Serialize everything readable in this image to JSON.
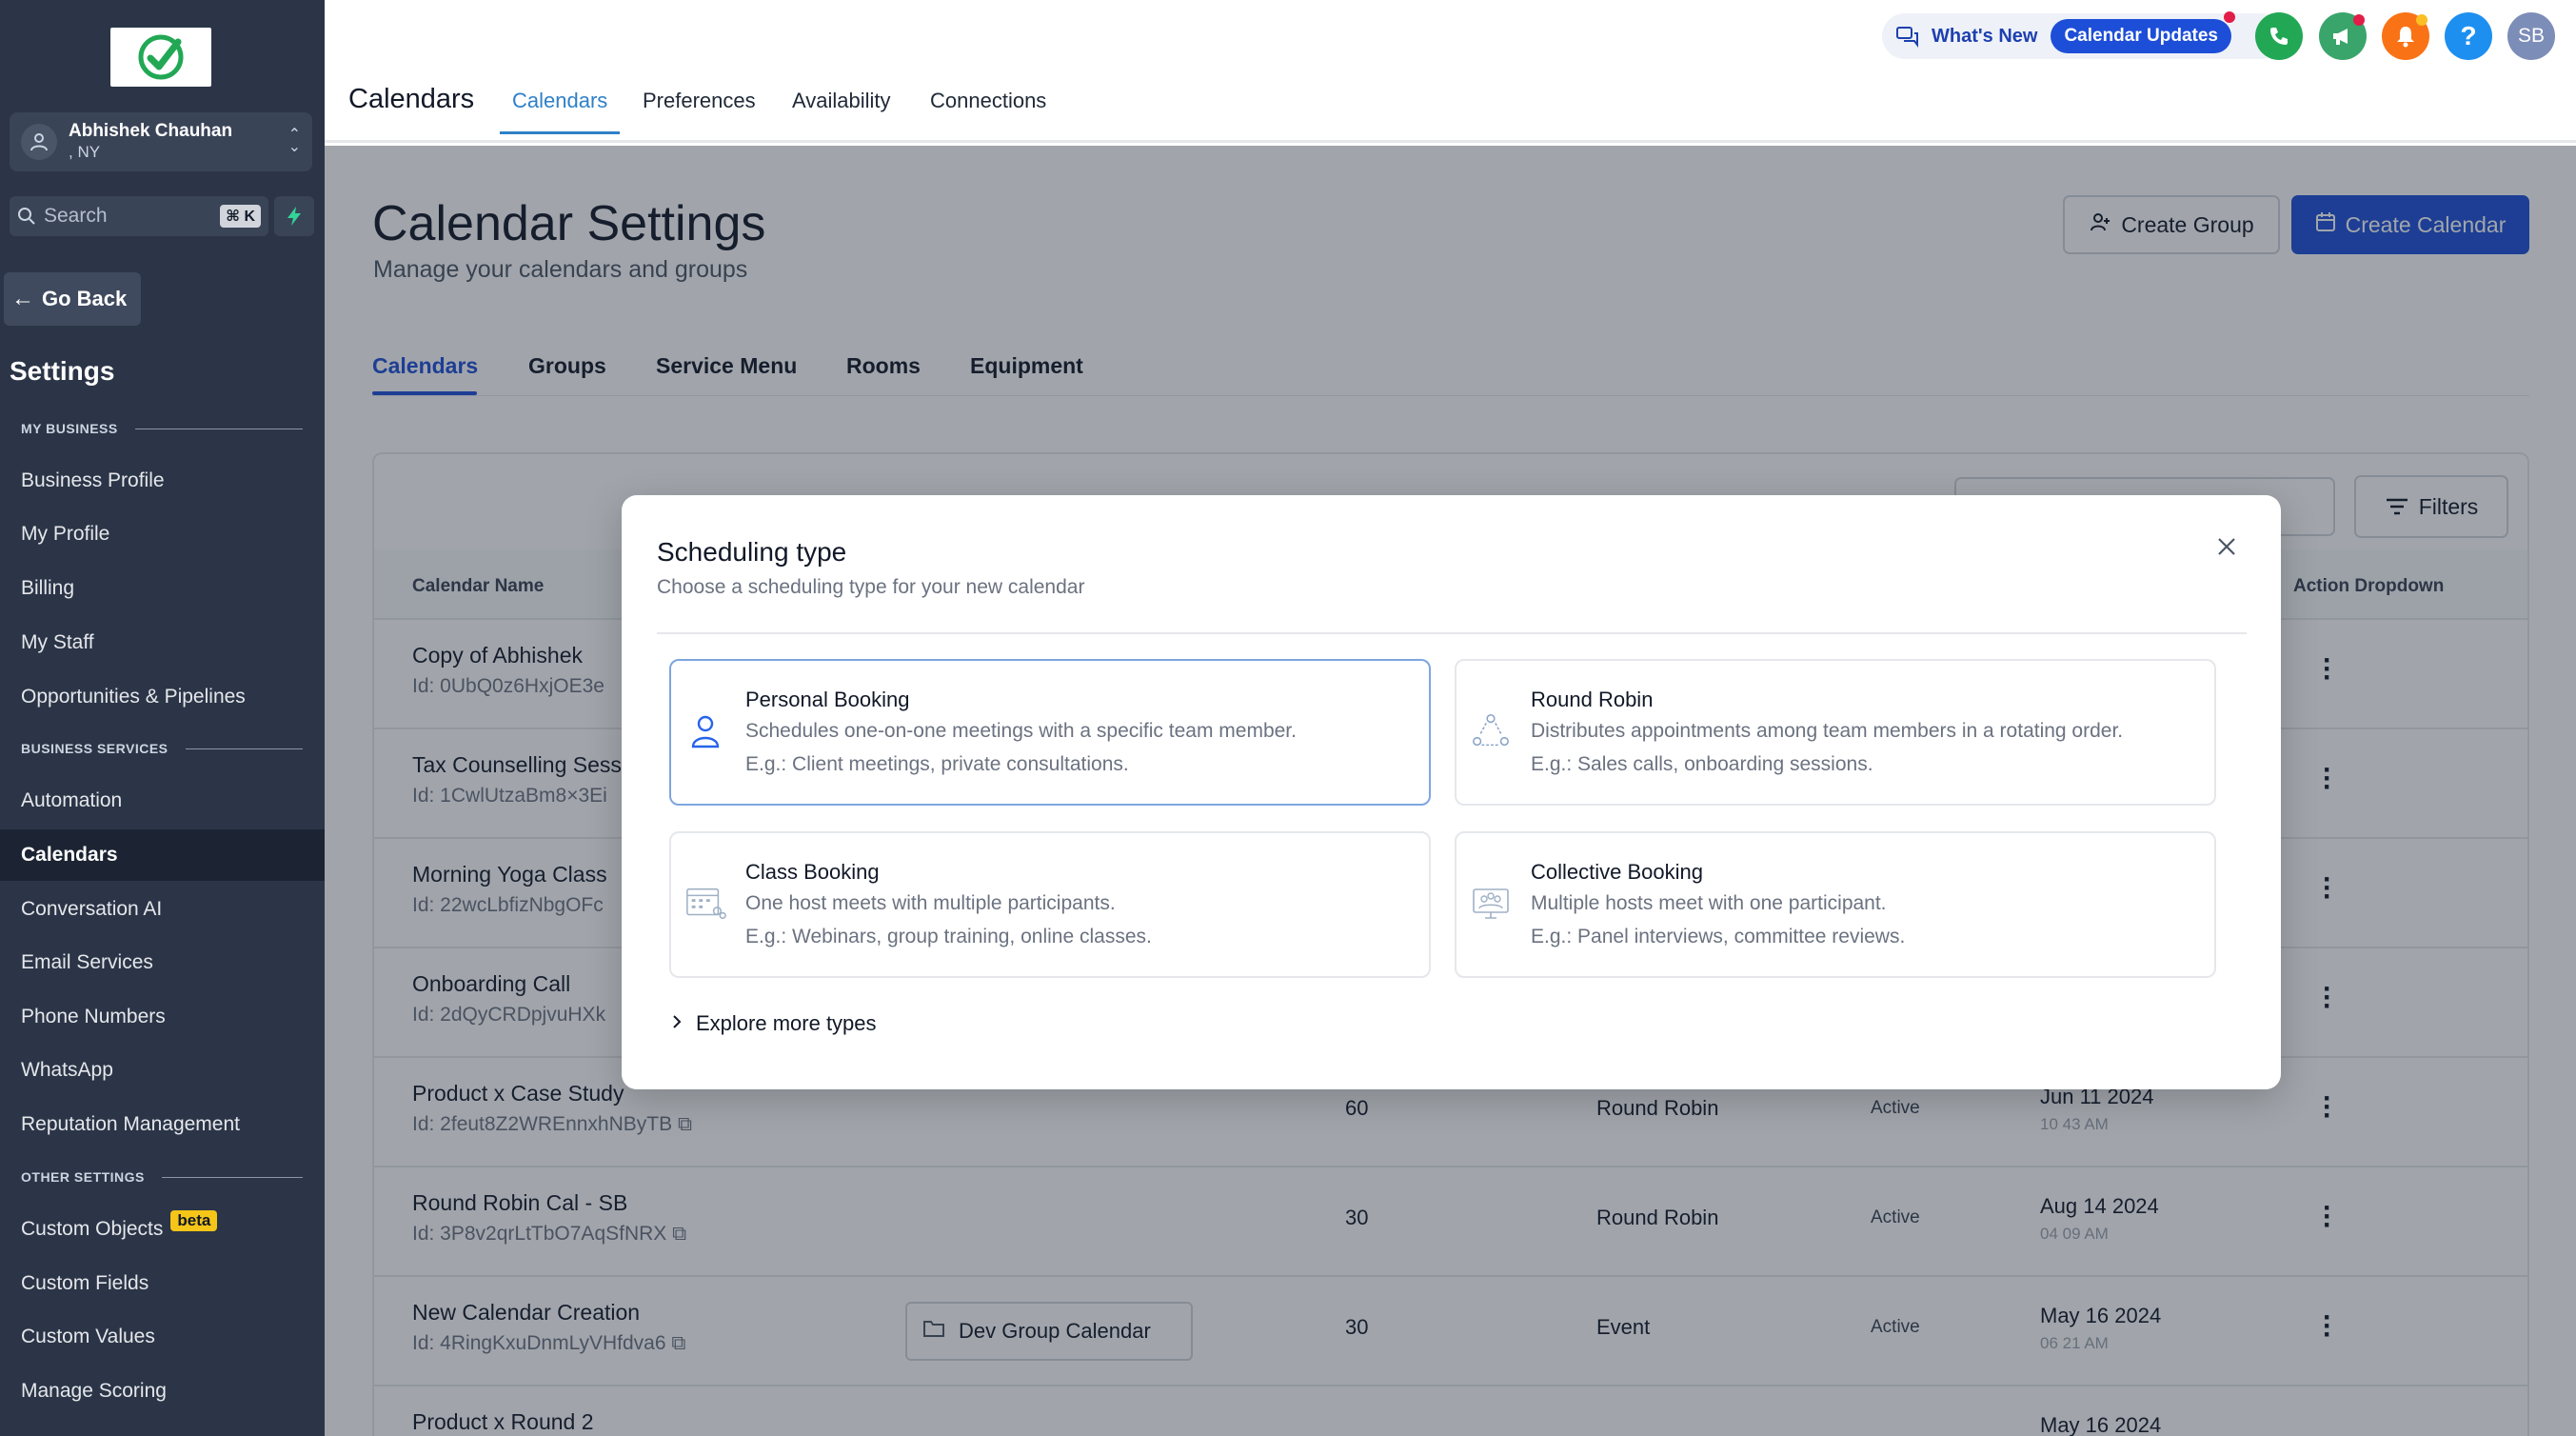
{
  "sidebar": {
    "account": {
      "name": "Abhishek Chauhan",
      "location": ", NY"
    },
    "search": {
      "placeholder": "Search",
      "shortcut": "⌘ K"
    },
    "go_back": "Go Back",
    "title": "Settings",
    "sections": {
      "my_business": "MY BUSINESS",
      "business_services": "BUSINESS SERVICES",
      "other_settings": "OTHER SETTINGS"
    },
    "items": [
      {
        "label": "Business Profile"
      },
      {
        "label": "My Profile"
      },
      {
        "label": "Billing"
      },
      {
        "label": "My Staff"
      },
      {
        "label": "Opportunities & Pipelines"
      },
      {
        "label": "Automation"
      },
      {
        "label": "Calendars"
      },
      {
        "label": "Conversation AI"
      },
      {
        "label": "Email Services"
      },
      {
        "label": "Phone Numbers"
      },
      {
        "label": "WhatsApp"
      },
      {
        "label": "Reputation Management"
      },
      {
        "label": "Custom Objects",
        "badge": "beta"
      },
      {
        "label": "Custom Fields"
      },
      {
        "label": "Custom Values"
      },
      {
        "label": "Manage Scoring"
      }
    ]
  },
  "header": {
    "title": "Calendars",
    "tabs": [
      "Calendars",
      "Preferences",
      "Availability",
      "Connections"
    ],
    "whats_new": "What's New",
    "calendar_updates": "Calendar Updates",
    "avatar": "SB",
    "help": "?"
  },
  "main": {
    "title": "Calendar Settings",
    "subtitle": "Manage your calendars and groups",
    "create_group": "Create Group",
    "create_calendar": "Create Calendar",
    "subtabs": [
      "Calendars",
      "Groups",
      "Service Menu",
      "Rooms",
      "Equipment"
    ],
    "filters": "Filters",
    "columns": {
      "name": "Calendar Name",
      "action": "Action Dropdown"
    },
    "rows": [
      {
        "name": "Copy of Abhishek",
        "id": "Id: 0UbQ0z6HxjOE3e"
      },
      {
        "name": "Tax Counselling Sess",
        "id": "Id: 1CwlUtzaBm8×3Ei"
      },
      {
        "name": "Morning Yoga Class",
        "id": "Id: 22wcLbfizNbgOFc"
      },
      {
        "name": "Onboarding Call",
        "id": "Id: 2dQyCRDpjvuHXk"
      },
      {
        "name": "Product x Case Study",
        "id": "Id: 2feut8Z2WREnnxhNByTB",
        "duration": "60",
        "type": "Round Robin",
        "status": "Active",
        "date": "Jun 11 2024",
        "time": "10 43 AM"
      },
      {
        "name": "Round Robin Cal - SB",
        "id": "Id: 3P8v2qrLtTbO7AqSfNRX",
        "duration": "30",
        "type": "Round Robin",
        "status": "Active",
        "date": "Aug 14 2024",
        "time": "04 09 AM"
      },
      {
        "name": "New Calendar Creation",
        "id": "Id: 4RingKxuDnmLyVHfdva6",
        "group": "Dev Group Calendar",
        "duration": "30",
        "type": "Event",
        "status": "Active",
        "date": "May 16 2024",
        "time": "06 21 AM"
      },
      {
        "name": "Product x Round 2",
        "date": "May 16 2024"
      }
    ]
  },
  "modal": {
    "title": "Scheduling type",
    "subtitle": "Choose a scheduling type for your new calendar",
    "options": [
      {
        "title": "Personal Booking",
        "desc": "Schedules one-on-one meetings with a specific team member.",
        "example": "E.g.: Client meetings, private consultations.",
        "icon": "person-icon"
      },
      {
        "title": "Round Robin",
        "desc": "Distributes appointments among team members in a rotating order.",
        "example": "E.g.: Sales calls, onboarding sessions.",
        "icon": "rotation-icon"
      },
      {
        "title": "Class Booking",
        "desc": "One host meets with multiple participants.",
        "example": "E.g.: Webinars, group training, online classes.",
        "icon": "class-icon"
      },
      {
        "title": "Collective Booking",
        "desc": "Multiple hosts meet with one participant.",
        "example": "E.g.: Panel interviews, committee reviews.",
        "icon": "collective-icon"
      }
    ],
    "explore": "Explore more types"
  },
  "colors": {
    "sidebar_bg": "#2b3547",
    "accent": "#1d4ed8",
    "tab_active": "#2f80c8",
    "badge": "#f5c518"
  }
}
